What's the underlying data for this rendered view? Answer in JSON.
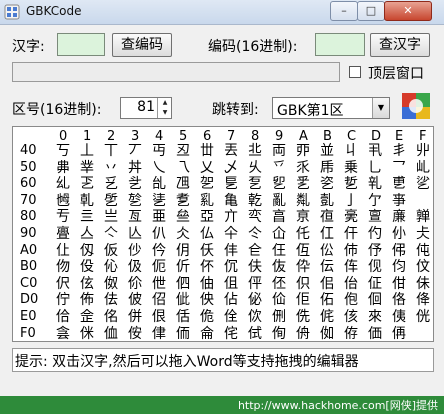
{
  "window": {
    "title": "GBKCode",
    "min_glyph": "–",
    "max_glyph": "□",
    "close_glyph": "✕"
  },
  "controls": {
    "hanzi_label": "汉字:",
    "find_code_button": "查编码",
    "code_label": "编码(16进制):",
    "find_char_button": "查汉字",
    "topmost_label": "顶层窗口",
    "area_label": "区号(16进制):",
    "area_value": "81",
    "jump_label": "跳转到:",
    "jump_value": "GBK第1区"
  },
  "grid": {
    "col_headers": [
      "0",
      "1",
      "2",
      "3",
      "4",
      "5",
      "6",
      "7",
      "8",
      "9",
      "A",
      "B",
      "C",
      "D",
      "E",
      "F"
    ],
    "row_labels": [
      "40",
      "50",
      "60",
      "70",
      "80",
      "90",
      "A0",
      "B0",
      "C0",
      "D0",
      "E0",
      "F0"
    ],
    "chars": [
      [
        "丂",
        "丄",
        "丅",
        "丆",
        "丏",
        "丒",
        "丗",
        "丟",
        "丠",
        "両",
        "丣",
        "並",
        "丩",
        "丮",
        "丯",
        "丱"
      ],
      [
        "丳",
        "丵",
        "丷",
        "丼",
        "乀",
        "乁",
        "乂",
        "乄",
        "乆",
        "乊",
        "乑",
        "乕",
        "乗",
        "乚",
        "乛",
        "乢"
      ],
      [
        "乣",
        "乤",
        "乥",
        "乧",
        "乨",
        "乪",
        "乫",
        "乬",
        "乭",
        "乮",
        "乯",
        "乲",
        "乴",
        "乵",
        "乶",
        "乷"
      ],
      [
        "乸",
        "乹",
        "乺",
        "乻",
        "乼",
        "乽",
        "乿",
        "亀",
        "亁",
        "亂",
        "亃",
        "亄",
        "亅",
        "亇",
        "亊",
        " "
      ],
      [
        "亐",
        "亖",
        "亗",
        "亙",
        "亜",
        "亝",
        "亞",
        "亣",
        "亪",
        "亯",
        "亰",
        "亱",
        "亴",
        "亶",
        "亷",
        "亸"
      ],
      [
        "亹",
        "亼",
        "亽",
        "亾",
        "仈",
        "仌",
        "仏",
        "仐",
        "仒",
        "仚",
        "仛",
        "仜",
        "仠",
        "仢",
        "仦",
        "仧"
      ],
      [
        "仩",
        "仭",
        "仮",
        "仯",
        "仱",
        "仴",
        "仸",
        "仹",
        "仺",
        "仼",
        "仾",
        "伀",
        "伂",
        "伃",
        "伄",
        "伅"
      ],
      [
        "伆",
        "伇",
        "伈",
        "伋",
        "伌",
        "伒",
        "伓",
        "伔",
        "伕",
        "伖",
        "伜",
        "伝",
        "伡",
        "伣",
        "伨",
        "伩"
      ],
      [
        "伬",
        "伭",
        "伮",
        "伱",
        "伳",
        "伵",
        "伷",
        "伹",
        "伻",
        "伾",
        "伿",
        "佀",
        "佁",
        "佂",
        "佄",
        "佅"
      ],
      [
        "佇",
        "佈",
        "佉",
        "佊",
        "佋",
        "佌",
        "佒",
        "佔",
        "佖",
        "佡",
        "佢",
        "佦",
        "佨",
        "佪",
        "佫",
        "佭"
      ],
      [
        "佮",
        "佱",
        "佲",
        "併",
        "佷",
        "佸",
        "佹",
        "佺",
        "佽",
        "侀",
        "侁",
        "侂",
        "侅",
        "來",
        "侇",
        "侊"
      ],
      [
        "侌",
        "侎",
        "侐",
        "侒",
        "侓",
        "侕",
        "侖",
        "侘",
        "侙",
        "侚",
        "侜",
        "侞",
        "侟",
        "価",
        "侢",
        " "
      ]
    ]
  },
  "status": {
    "hint": "提示: 双击汉字,然后可以拖入Word等支持拖拽的编辑器"
  },
  "footer": {
    "text": "http://www.hackhome.com[网侠]提供"
  },
  "colors": {
    "input_bg": "#dcf3dc",
    "footer_bg": "#2e8b3a"
  }
}
